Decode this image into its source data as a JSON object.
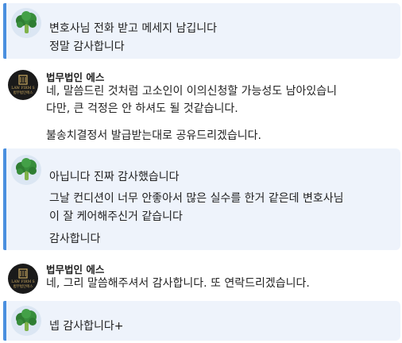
{
  "messages": [
    {
      "sender": "user",
      "lines": [
        "변호사님 전화 받고 메세지 남깁니다",
        "정말 감사합니다"
      ]
    },
    {
      "sender": "lawyer",
      "name": "법무법인 에스",
      "logo_text": [
        "LAW FIRM S",
        "법무법인에스"
      ],
      "lines": [
        "네, 말씀드린 것처럼 고소인이 이의신청할 가능성도 남아있습니",
        "다만, 큰 걱정은 안 하셔도 될 것같습니다.",
        "불송치결정서 발급받는대로 공유드리겠습니다."
      ]
    },
    {
      "sender": "user",
      "lines": [
        "아닙니다 진짜 감사했습니다",
        "그날 컨디션이 너무 안좋아서 많은 실수를 한거 같은데 변호사님",
        "이 잘 케어해주신거 같습니다",
        "감사합니다"
      ]
    },
    {
      "sender": "lawyer",
      "name": "법무법인 에스",
      "logo_text": [
        "LAW FIRM S",
        "법무법인에스"
      ],
      "lines": [
        "네, 그리 말씀해주셔서 감사합니다. 또 연락드리겠습니다."
      ]
    },
    {
      "sender": "user",
      "lines": [
        "넵 감사합니다+"
      ]
    }
  ],
  "colors": {
    "user_bg": "#eef3fb",
    "accent": "#4a8fdf",
    "logo_gold": "#c9a860"
  }
}
